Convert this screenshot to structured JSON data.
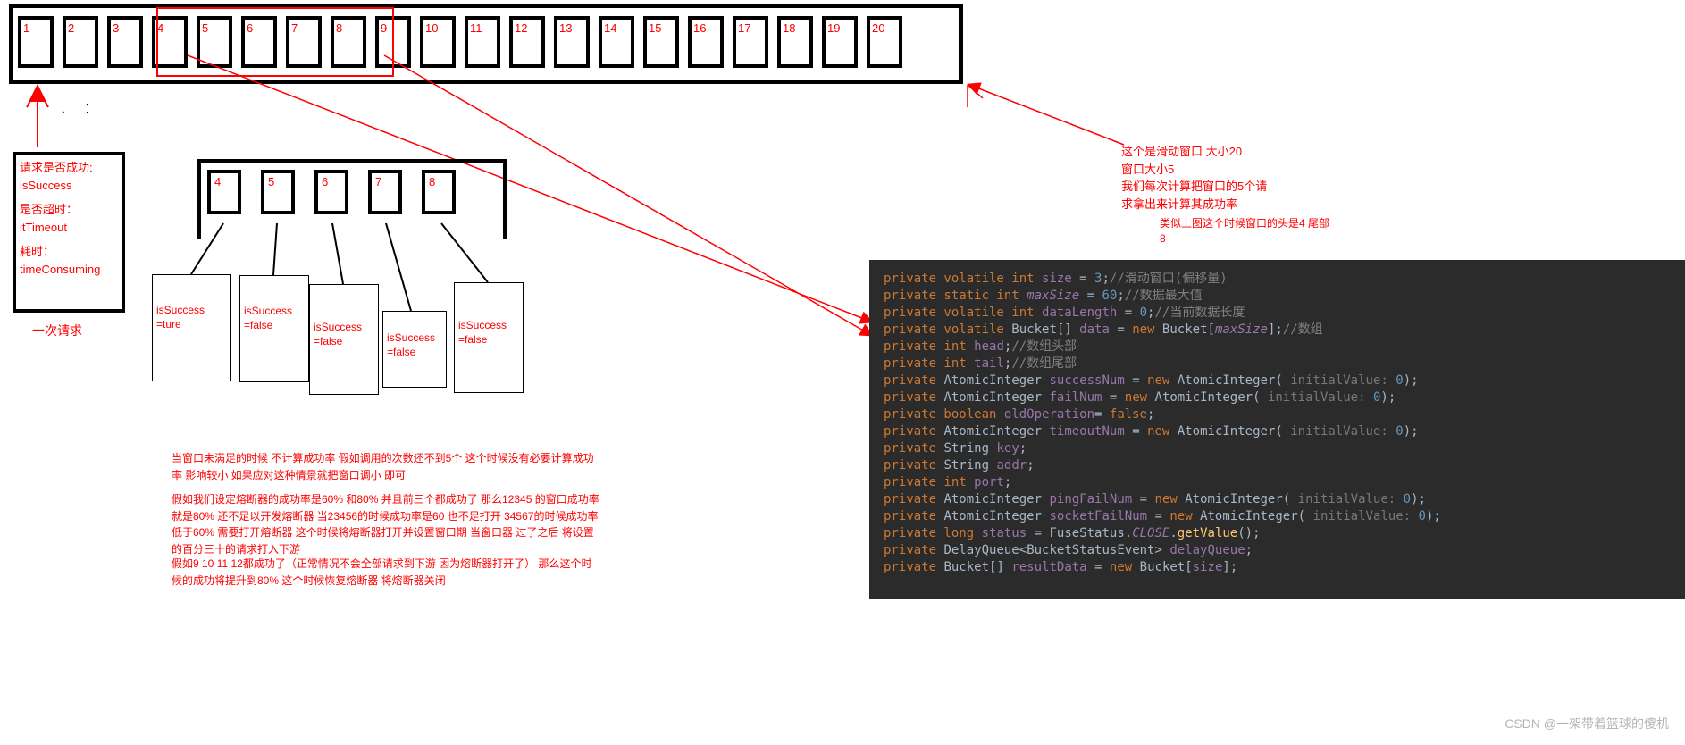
{
  "top_buckets": [
    "1",
    "2",
    "3",
    "4",
    "5",
    "6",
    "7",
    "8",
    "9",
    "10",
    "11",
    "12",
    "13",
    "14",
    "15",
    "16",
    "17",
    "18",
    "19",
    "20"
  ],
  "window": {
    "highlight_start_index": 3,
    "highlight_end_index": 7
  },
  "dots": ". :",
  "info_box": {
    "line1": "请求是否成功:",
    "line2": "isSuccess",
    "line3": "是否超时：",
    "line4": "itTimeout",
    "line5": "耗时：",
    "line6": "timeConsuming"
  },
  "info_caption": "一次请求",
  "sub_buckets": [
    "4",
    "5",
    "6",
    "7",
    "8"
  ],
  "details": [
    {
      "l1": "isSuccess",
      "l2": "=ture"
    },
    {
      "l1": "isSuccess",
      "l2": "=false"
    },
    {
      "l1": "isSuccess",
      "l2": "=false"
    },
    {
      "l1": "isSuccess",
      "l2": "=false"
    },
    {
      "l1": "isSuccess",
      "l2": "=false"
    }
  ],
  "paragraphs": {
    "p1": "当窗口未满足的时候 不计算成功率 假如调用的次数还不到5个 这个时候没有必要计算成功率 影响较小 如果应对这种情景就把窗口调小 即可",
    "p2": "假如我们设定熔断器的成功率是60% 和80% 并且前三个都成功了 那么12345 的窗口成功率就是80% 还不足以开发熔断器 当23456的时候成功率是60 也不足打开 34567的时候成功率低于60% 需要打开熔断器   这个时候将熔断器打开并设置窗口期 当窗口器 过了之后 将设置的百分三十的请求打入下游",
    "p3": "假如9 10 11 12都成功了（正常情况不会全部请求到下游 因为熔断器打开了） 那么这个时候的成功将提升到80% 这个时候恢复熔断器 将熔断器关闭"
  },
  "right_note": "这个是滑动窗口 大小20\n窗口大小5\n我们每次计算把窗口的5个请求拿出来计算其成功率",
  "right_note2": "类似上图这个时候窗口的头是4 尾部 8",
  "code_lines": [
    {
      "t": "private volatile int size = 3;",
      "c": "//滑动窗口(偏移量)"
    },
    {
      "t": "private static int maxSize = 60;",
      "c": "//数据最大值",
      "italicVar": "maxSize"
    },
    {
      "t": "private volatile int dataLength = 0;",
      "c": "//当前数据长度"
    },
    {
      "t": "private volatile Bucket[] data = new Bucket[maxSize];",
      "c": "//数组",
      "italicVar": "maxSize"
    },
    {
      "t": "private int head;",
      "c": "//数组头部"
    },
    {
      "t": "private int tail;",
      "c": "//数组尾部"
    },
    {
      "t": "private AtomicInteger successNum = new AtomicInteger( initialValue: 0);",
      "c": ""
    },
    {
      "t": "private AtomicInteger failNum = new AtomicInteger( initialValue: 0);",
      "c": ""
    },
    {
      "t": "private boolean oldOperation= false;",
      "c": ""
    },
    {
      "t": "private AtomicInteger timeoutNum = new AtomicInteger( initialValue: 0);",
      "c": ""
    },
    {
      "t": "private String key;",
      "c": ""
    },
    {
      "t": "private String addr;",
      "c": ""
    },
    {
      "t": "private int port;",
      "c": ""
    },
    {
      "t": "private AtomicInteger pingFailNum = new AtomicInteger( initialValue: 0);",
      "c": ""
    },
    {
      "t": "private AtomicInteger socketFailNum = new AtomicInteger( initialValue: 0);",
      "c": ""
    },
    {
      "t": "private long status = FuseStatus.CLOSE.getValue();",
      "c": "",
      "italicVar": "CLOSE"
    },
    {
      "t": "private DelayQueue<BucketStatusEvent> delayQueue;",
      "c": ""
    },
    {
      "t": "private Bucket[] resultData = new Bucket[size];",
      "c": ""
    }
  ],
  "watermark": "CSDN @一架带着篮球的傻机",
  "chart_data": {
    "type": "area",
    "title": "Sliding window ring buffer diagram",
    "x": [
      1,
      2,
      3,
      4,
      5,
      6,
      7,
      8,
      9,
      10,
      11,
      12,
      13,
      14,
      15,
      16,
      17,
      18,
      19,
      20
    ],
    "window_head": 4,
    "window_tail": 8,
    "window_size": 5,
    "total_size": 20,
    "sub_results": {
      "4": "isSuccess=ture",
      "5": "isSuccess=false",
      "6": "isSuccess=false",
      "7": "isSuccess=false",
      "8": "isSuccess=false"
    }
  }
}
